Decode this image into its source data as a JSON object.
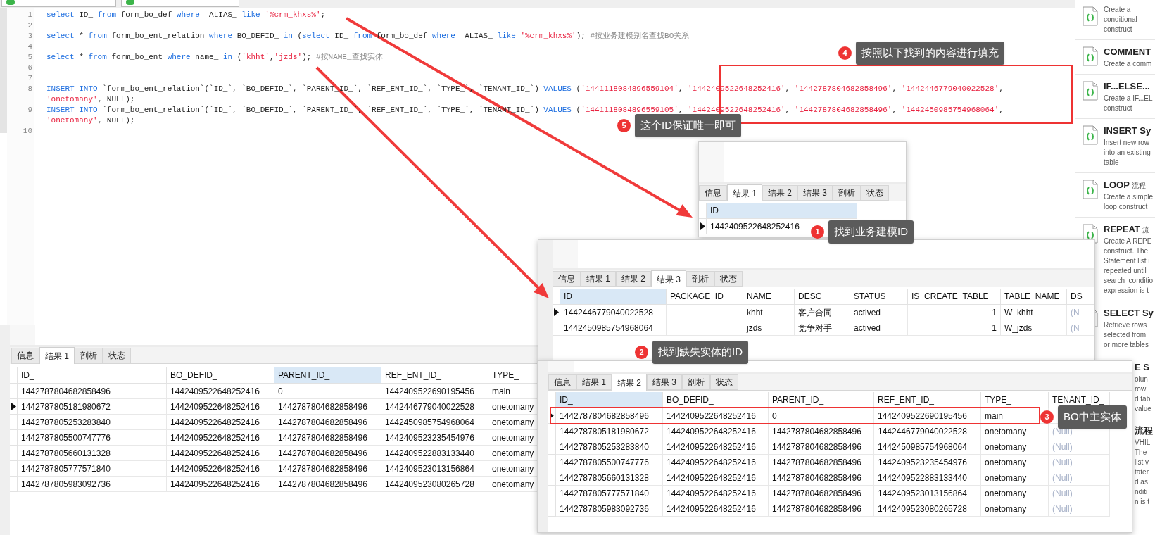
{
  "editor": {
    "lines": [
      {
        "number": "1",
        "rows": [
          [
            {
              "kind": "keyword",
              "text": "select"
            },
            {
              "kind": "plain",
              "text": " ID_ "
            },
            {
              "kind": "keyword",
              "text": "from"
            },
            {
              "kind": "plain",
              "text": " form_bo_def "
            },
            {
              "kind": "keyword",
              "text": "where"
            },
            {
              "kind": "plain",
              "text": "  ALIAS_ "
            },
            {
              "kind": "keyword",
              "text": "like"
            },
            {
              "kind": "plain",
              "text": " "
            },
            {
              "kind": "string",
              "text": "'%crm_khxs%'"
            },
            {
              "kind": "plain",
              "text": ";"
            }
          ]
        ]
      },
      {
        "number": "2"
      },
      {
        "number": "3",
        "rows": [
          [
            {
              "kind": "keyword",
              "text": "select"
            },
            {
              "kind": "plain",
              "text": " * "
            },
            {
              "kind": "keyword",
              "text": "from"
            },
            {
              "kind": "plain",
              "text": " form_bo_ent_relation "
            },
            {
              "kind": "keyword",
              "text": "where"
            },
            {
              "kind": "plain",
              "text": " BO_DEFID_ "
            },
            {
              "kind": "keyword",
              "text": "in"
            },
            {
              "kind": "plain",
              "text": " ("
            },
            {
              "kind": "keyword",
              "text": "select"
            },
            {
              "kind": "plain",
              "text": " ID_ "
            },
            {
              "kind": "keyword",
              "text": "from"
            },
            {
              "kind": "plain",
              "text": " form_bo_def "
            },
            {
              "kind": "keyword",
              "text": "where"
            },
            {
              "kind": "plain",
              "text": "  ALIAS_ "
            },
            {
              "kind": "keyword",
              "text": "like"
            },
            {
              "kind": "plain",
              "text": " "
            },
            {
              "kind": "string",
              "text": "'%crm_khxs%'"
            },
            {
              "kind": "plain",
              "text": "); "
            },
            {
              "kind": "comment",
              "text": "#按业务建模别名查找BO关系"
            }
          ]
        ]
      },
      {
        "number": "4"
      },
      {
        "number": "5",
        "rows": [
          [
            {
              "kind": "keyword",
              "text": "select"
            },
            {
              "kind": "plain",
              "text": " * "
            },
            {
              "kind": "keyword",
              "text": "from"
            },
            {
              "kind": "plain",
              "text": " form_bo_ent "
            },
            {
              "kind": "keyword",
              "text": "where"
            },
            {
              "kind": "plain",
              "text": " name_ "
            },
            {
              "kind": "keyword",
              "text": "in"
            },
            {
              "kind": "plain",
              "text": " ("
            },
            {
              "kind": "string",
              "text": "'khht'"
            },
            {
              "kind": "plain",
              "text": ","
            },
            {
              "kind": "string",
              "text": "'jzds'"
            },
            {
              "kind": "plain",
              "text": "); "
            },
            {
              "kind": "comment",
              "text": "#按NAME_查找实体"
            }
          ]
        ]
      },
      {
        "number": "6"
      },
      {
        "number": "7"
      },
      {
        "number": "8",
        "rows": [
          [
            {
              "kind": "keyword",
              "text": "INSERT INTO"
            },
            {
              "kind": "plain",
              "text": " `form_bo_ent_relation`(`ID_`, `BO_DEFID_`, `PARENT_ID_`, `REF_ENT_ID_`, `TYPE_`, `TENANT_ID_`) "
            },
            {
              "kind": "keyword",
              "text": "VALUES"
            },
            {
              "kind": "plain",
              "text": " ("
            },
            {
              "kind": "string",
              "text": "'1441118084896559104'"
            },
            {
              "kind": "plain",
              "text": ", "
            },
            {
              "kind": "string",
              "text": "'1442409522648252416'"
            },
            {
              "kind": "plain",
              "text": ", "
            },
            {
              "kind": "string",
              "text": "'1442787804682858496'"
            },
            {
              "kind": "plain",
              "text": ", "
            },
            {
              "kind": "string",
              "text": "'1442446779040022528'"
            },
            {
              "kind": "plain",
              "text": ","
            }
          ],
          [
            {
              "kind": "string",
              "text": "'onetomany'"
            },
            {
              "kind": "plain",
              "text": ", NULL);"
            }
          ]
        ]
      },
      {
        "number": "9",
        "rows": [
          [
            {
              "kind": "keyword",
              "text": "INSERT INTO"
            },
            {
              "kind": "plain",
              "text": " `form_bo_ent_relation`(`ID_`, `BO_DEFID_`, `PARENT_ID_`, `REF_ENT_ID_`, `TYPE_`, `TENANT_ID_`) "
            },
            {
              "kind": "keyword",
              "text": "VALUES"
            },
            {
              "kind": "plain",
              "text": " ("
            },
            {
              "kind": "string",
              "text": "'1441118084896559105'"
            },
            {
              "kind": "plain",
              "text": ", "
            },
            {
              "kind": "string",
              "text": "'1442409522648252416'"
            },
            {
              "kind": "plain",
              "text": ", "
            },
            {
              "kind": "string",
              "text": "'1442787804682858496'"
            },
            {
              "kind": "plain",
              "text": ", "
            },
            {
              "kind": "string",
              "text": "'1442450985754968064'"
            },
            {
              "kind": "plain",
              "text": ","
            }
          ],
          [
            {
              "kind": "string",
              "text": "'onetomany'"
            },
            {
              "kind": "plain",
              "text": ", NULL);"
            }
          ]
        ]
      },
      {
        "number": "10"
      }
    ]
  },
  "bottom_results": {
    "tabs": [
      {
        "label": "信息",
        "selected": false
      },
      {
        "label": "结果 1",
        "selected": true
      },
      {
        "label": "剖析",
        "selected": false
      },
      {
        "label": "状态",
        "selected": false
      }
    ],
    "columns": [
      {
        "label": "ID_",
        "selected": false
      },
      {
        "label": "BO_DEFID_",
        "selected": false
      },
      {
        "label": "PARENT_ID_",
        "selected": true
      },
      {
        "label": "REF_ENT_ID_",
        "selected": false
      },
      {
        "label": "TYPE_",
        "selected": false
      }
    ],
    "rows": [
      {
        "selected": false,
        "cells": [
          "1442787804682858496",
          "1442409522648252416",
          "0",
          "1442409522690195456",
          "main"
        ]
      },
      {
        "selected": true,
        "cells": [
          "1442787805181980672",
          "1442409522648252416",
          "1442787804682858496",
          "1442446779040022528",
          "onetomany"
        ]
      },
      {
        "selected": false,
        "cells": [
          "1442787805253283840",
          "1442409522648252416",
          "1442787804682858496",
          "1442450985754968064",
          "onetomany"
        ]
      },
      {
        "selected": false,
        "cells": [
          "1442787805500747776",
          "1442409522648252416",
          "1442787804682858496",
          "1442409523235454976",
          "onetomany"
        ]
      },
      {
        "selected": false,
        "cells": [
          "1442787805660131328",
          "1442409522648252416",
          "1442787804682858496",
          "1442409522883133440",
          "onetomany"
        ]
      },
      {
        "selected": false,
        "cells": [
          "1442787805777571840",
          "1442409522648252416",
          "1442787804682858496",
          "1442409523013156864",
          "onetomany"
        ]
      },
      {
        "selected": false,
        "cells": [
          "1442787805983092736",
          "1442409522648252416",
          "1442787804682858496",
          "1442409523080265728",
          "onetomany"
        ]
      }
    ]
  },
  "result_panels": [
    {
      "tabs": [
        {
          "label": "信息",
          "selected": false
        },
        {
          "label": "结果 1",
          "selected": true
        },
        {
          "label": "结果 2",
          "selected": false
        },
        {
          "label": "结果 3",
          "selected": false
        },
        {
          "label": "剖析",
          "selected": false
        },
        {
          "label": "状态",
          "selected": false
        }
      ],
      "columns": [
        {
          "label": "ID_",
          "selected": true
        }
      ],
      "rows": [
        {
          "selected": true,
          "cells": [
            "1442409522648252416"
          ]
        }
      ]
    },
    {
      "tabs": [
        {
          "label": "信息",
          "selected": false
        },
        {
          "label": "结果 1",
          "selected": false
        },
        {
          "label": "结果 2",
          "selected": false
        },
        {
          "label": "结果 3",
          "selected": true
        },
        {
          "label": "剖析",
          "selected": false
        },
        {
          "label": "状态",
          "selected": false
        }
      ],
      "columns": [
        {
          "label": "ID_",
          "selected": true
        },
        {
          "label": "PACKAGE_ID_",
          "selected": false
        },
        {
          "label": "NAME_",
          "selected": false
        },
        {
          "label": "DESC_",
          "selected": false
        },
        {
          "label": "STATUS_",
          "selected": false
        },
        {
          "label": "IS_CREATE_TABLE_",
          "selected": false
        },
        {
          "label": "TABLE_NAME_",
          "selected": false
        },
        {
          "label": "DS",
          "selected": false,
          "muted": true
        }
      ],
      "rows": [
        {
          "selected": true,
          "cells": [
            "1442446779040022528",
            null,
            "khht",
            "客户合同",
            "actived",
            "1",
            "W_khht",
            "(N"
          ]
        },
        {
          "selected": false,
          "cells": [
            "1442450985754968064",
            null,
            "jzds",
            "竞争对手",
            "actived",
            "1",
            "W_jzds",
            "(N"
          ]
        }
      ]
    },
    {
      "tabs": [
        {
          "label": "信息",
          "selected": false
        },
        {
          "label": "结果 1",
          "selected": false
        },
        {
          "label": "结果 2",
          "selected": true
        },
        {
          "label": "结果 3",
          "selected": false
        },
        {
          "label": "剖析",
          "selected": false
        },
        {
          "label": "状态",
          "selected": false
        }
      ],
      "columns": [
        {
          "label": "ID_",
          "selected": true
        },
        {
          "label": "BO_DEFID_",
          "selected": false
        },
        {
          "label": "PARENT_ID_",
          "selected": false
        },
        {
          "label": "REF_ENT_ID_",
          "selected": false
        },
        {
          "label": "TYPE_",
          "selected": false
        },
        {
          "label": "TENANT_ID_",
          "selected": false,
          "muted": true
        }
      ],
      "rows": [
        {
          "selected": true,
          "cells": [
            "1442787804682858496",
            "1442409522648252416",
            "0",
            "1442409522690195456",
            "main",
            null
          ]
        },
        {
          "selected": false,
          "cells": [
            "1442787805181980672",
            "1442409522648252416",
            "1442787804682858496",
            "1442446779040022528",
            "onetomany",
            "(Null)"
          ]
        },
        {
          "selected": false,
          "cells": [
            "1442787805253283840",
            "1442409522648252416",
            "1442787804682858496",
            "1442450985754968064",
            "onetomany",
            "(Null)"
          ]
        },
        {
          "selected": false,
          "cells": [
            "1442787805500747776",
            "1442409522648252416",
            "1442787804682858496",
            "1442409523235454976",
            "onetomany",
            "(Null)"
          ]
        },
        {
          "selected": false,
          "cells": [
            "1442787805660131328",
            "1442409522648252416",
            "1442787804682858496",
            "1442409522883133440",
            "onetomany",
            "(Null)"
          ]
        },
        {
          "selected": false,
          "cells": [
            "1442787805777571840",
            "1442409522648252416",
            "1442787804682858496",
            "1442409523013156864",
            "onetomany",
            "(Null)"
          ]
        },
        {
          "selected": false,
          "cells": [
            "1442787805983092736",
            "1442409522648252416",
            "1442787804682858496",
            "1442409523080265728",
            "onetomany",
            "(Null)"
          ]
        }
      ]
    }
  ],
  "sidebar": {
    "items": [
      {
        "kind": "full",
        "description": [
          "Create a",
          "conditional",
          "construct"
        ]
      },
      {
        "kind": "full",
        "title": "COMMENT",
        "description": [
          "Create a comm"
        ]
      },
      {
        "kind": "full",
        "title": "IF...ELSE...",
        "description": [
          "Create a IF...EL",
          "construct"
        ]
      },
      {
        "kind": "full",
        "title": "INSERT Sy",
        "description": [
          "Insert new row",
          "into an existing",
          "table"
        ]
      },
      {
        "kind": "full",
        "title": "LOOP",
        "note": "流程",
        "description": [
          "Create a simple",
          "loop construct"
        ]
      },
      {
        "kind": "full",
        "title": "REPEAT",
        "note": "流",
        "description": [
          "Create A REPE",
          "construct. The",
          "Statement list i",
          "repeated until",
          "search_conditio",
          "expression is t"
        ]
      },
      {
        "kind": "full",
        "title": "SELECT Sy",
        "description": [
          "Retrieve rows",
          "selected from",
          "or more tables"
        ]
      },
      {
        "kind": "partial",
        "title": "E S",
        "description": [
          "olun",
          "row",
          "d tab",
          "value"
        ]
      },
      {
        "kind": "partial",
        "title": "流程",
        "description": [
          "VHIL",
          "The",
          "list v",
          "tater",
          "d as",
          "nditi",
          "n is t"
        ]
      }
    ]
  },
  "annotations": [
    {
      "number": "1",
      "text": "找到业务建模ID"
    },
    {
      "number": "2",
      "text": "找到缺失实体的ID"
    },
    {
      "number": "3",
      "text": "BO中主实体"
    },
    {
      "number": "4",
      "text": "按照以下找到的内容进行填充"
    },
    {
      "number": "5",
      "text": "这个ID保证唯一即可"
    }
  ]
}
